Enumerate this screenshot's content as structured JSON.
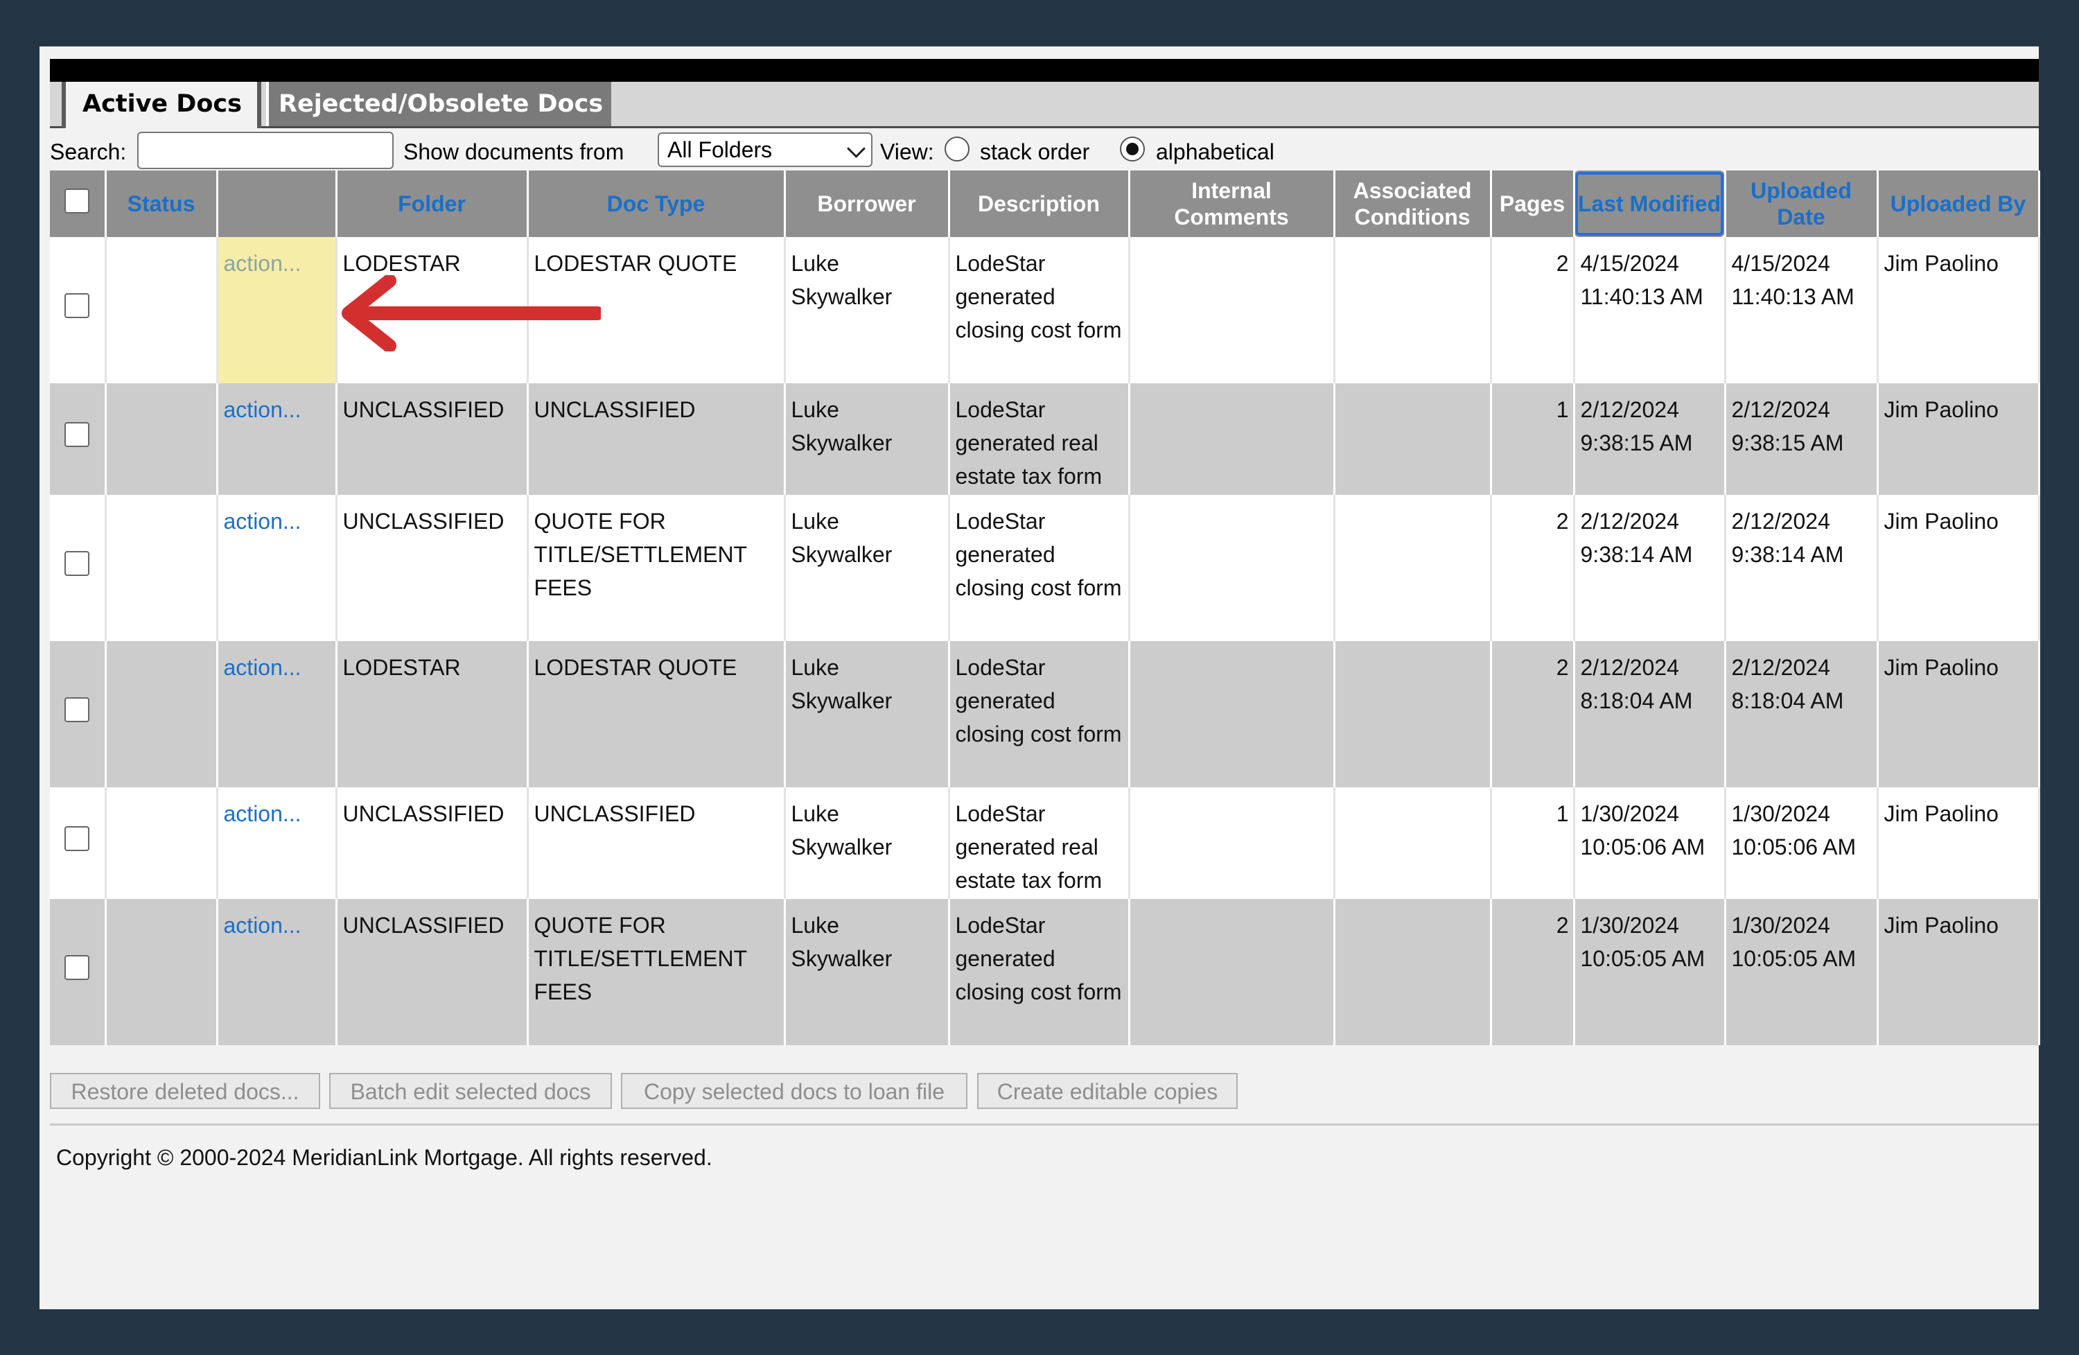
{
  "tabs": [
    {
      "label": "Active Docs",
      "active": true
    },
    {
      "label": "Rejected/Obsolete Docs",
      "active": false
    }
  ],
  "filters": {
    "search_label": "Search:",
    "search_value": "",
    "show_label": "Show documents from",
    "folder_selected": "All Folders",
    "view_label": "View:",
    "view_options": [
      {
        "label": "stack order",
        "checked": false
      },
      {
        "label": "alphabetical",
        "checked": true
      }
    ]
  },
  "table": {
    "headers": {
      "status": "Status",
      "action": "",
      "folder": "Folder",
      "doc_type": "Doc Type",
      "borrower": "Borrower",
      "description": "Description",
      "internal_comments": "Internal Comments",
      "associated_conditions": "Associated Conditions",
      "pages": "Pages",
      "last_modified": "Last Modified",
      "uploaded_date": "Uploaded Date",
      "uploaded_by": "Uploaded By"
    },
    "rows": [
      {
        "action": "action...",
        "folder": "LODESTAR",
        "doc_type": "LODESTAR QUOTE",
        "borrower": "Luke Skywalker",
        "description": "LodeStar generated closing cost form",
        "internal_comments": "",
        "associated_conditions": "",
        "pages": "2",
        "last_modified": "4/15/2024 11:40:13 AM",
        "uploaded_date": "4/15/2024 11:40:13 AM",
        "uploaded_by": "Jim Paolino"
      },
      {
        "action": "action...",
        "folder": "UNCLASSIFIED",
        "doc_type": "UNCLASSIFIED",
        "borrower": "Luke Skywalker",
        "description": "LodeStar generated real estate tax form",
        "internal_comments": "",
        "associated_conditions": "",
        "pages": "1",
        "last_modified": "2/12/2024 9:38:15 AM",
        "uploaded_date": "2/12/2024 9:38:15 AM",
        "uploaded_by": "Jim Paolino"
      },
      {
        "action": "action...",
        "folder": "UNCLASSIFIED",
        "doc_type": "QUOTE FOR TITLE/SETTLEMENT FEES",
        "borrower": "Luke Skywalker",
        "description": "LodeStar generated closing cost form",
        "internal_comments": "",
        "associated_conditions": "",
        "pages": "2",
        "last_modified": "2/12/2024 9:38:14 AM",
        "uploaded_date": "2/12/2024 9:38:14 AM",
        "uploaded_by": "Jim Paolino"
      },
      {
        "action": "action...",
        "folder": "LODESTAR",
        "doc_type": "LODESTAR QUOTE",
        "borrower": "Luke Skywalker",
        "description": "LodeStar generated closing cost form",
        "internal_comments": "",
        "associated_conditions": "",
        "pages": "2",
        "last_modified": "2/12/2024 8:18:04 AM",
        "uploaded_date": "2/12/2024 8:18:04 AM",
        "uploaded_by": "Jim Paolino"
      },
      {
        "action": "action...",
        "folder": "UNCLASSIFIED",
        "doc_type": "UNCLASSIFIED",
        "borrower": "Luke Skywalker",
        "description": "LodeStar generated real estate tax form",
        "internal_comments": "",
        "associated_conditions": "",
        "pages": "1",
        "last_modified": "1/30/2024 10:05:06 AM",
        "uploaded_date": "1/30/2024 10:05:06 AM",
        "uploaded_by": "Jim Paolino"
      },
      {
        "action": "action...",
        "folder": "UNCLASSIFIED",
        "doc_type": "QUOTE FOR TITLE/SETTLEMENT FEES",
        "borrower": "Luke Skywalker",
        "description": "LodeStar generated closing cost form",
        "internal_comments": "",
        "associated_conditions": "",
        "pages": "2",
        "last_modified": "1/30/2024 10:05:05 AM",
        "uploaded_date": "1/30/2024 10:05:05 AM",
        "uploaded_by": "Jim Paolino"
      }
    ]
  },
  "buttons": {
    "restore": "Restore deleted docs...",
    "batch_edit": "Batch edit selected docs",
    "copy": "Copy selected docs to loan file",
    "editable": "Create editable copies"
  },
  "footer": {
    "copyright": "Copyright © 2000-2024 MeridianLink Mortgage. All rights reserved."
  },
  "colors": {
    "link": "#1a6fc9",
    "header_bg": "#8f8f8f",
    "highlight": "#f6eda8",
    "arrow": "#d32f2f",
    "frame": "#243546"
  },
  "annotation": {
    "icon": "red-arrow-icon",
    "points_to": "action... link in first row"
  }
}
